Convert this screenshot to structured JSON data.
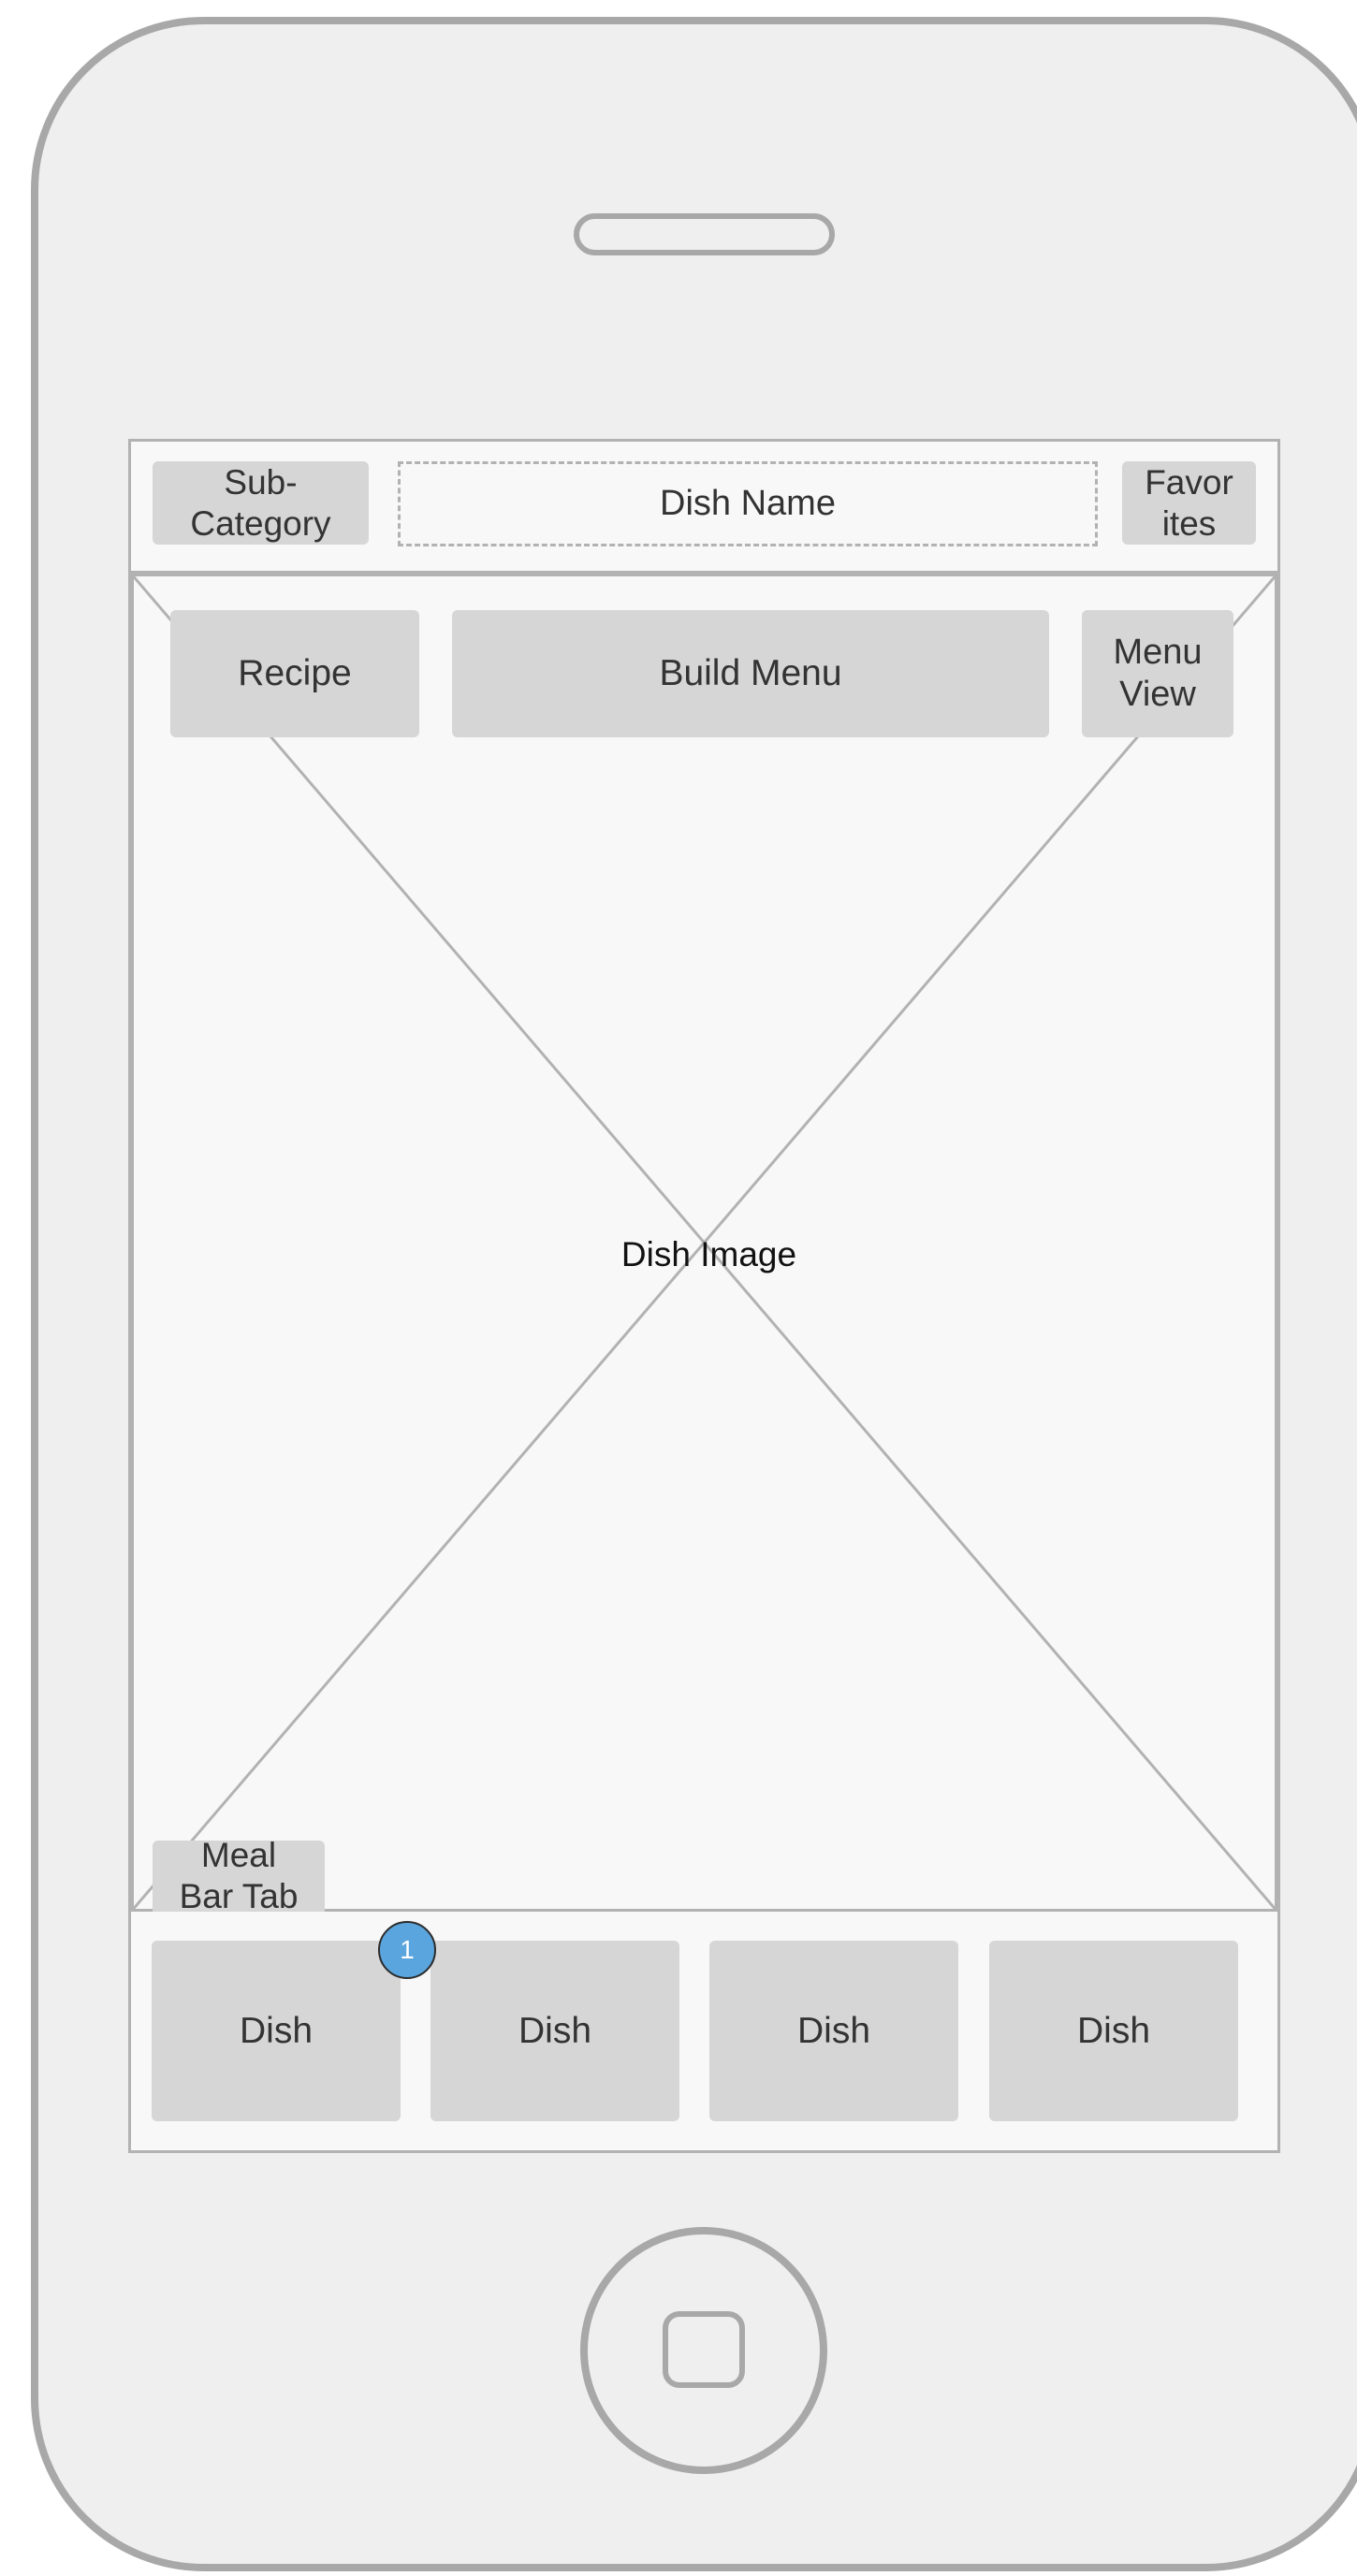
{
  "header": {
    "sub_category": "Sub-\nCategory",
    "dish_name": "Dish Name",
    "favorites": "Favor\nites"
  },
  "top_actions": {
    "recipe": "Recipe",
    "build_menu": "Build Menu",
    "menu_view": "Menu\nView"
  },
  "image": {
    "label": "Dish Image"
  },
  "meal_bar_tab": "Meal\nBar Tab",
  "badge": "1",
  "dishes": [
    "Dish",
    "Dish",
    "Dish",
    "Dish"
  ],
  "colors": {
    "outline": "#a8a8a8",
    "button_fill": "#d6d6d6",
    "badge": "#5aa5de"
  }
}
